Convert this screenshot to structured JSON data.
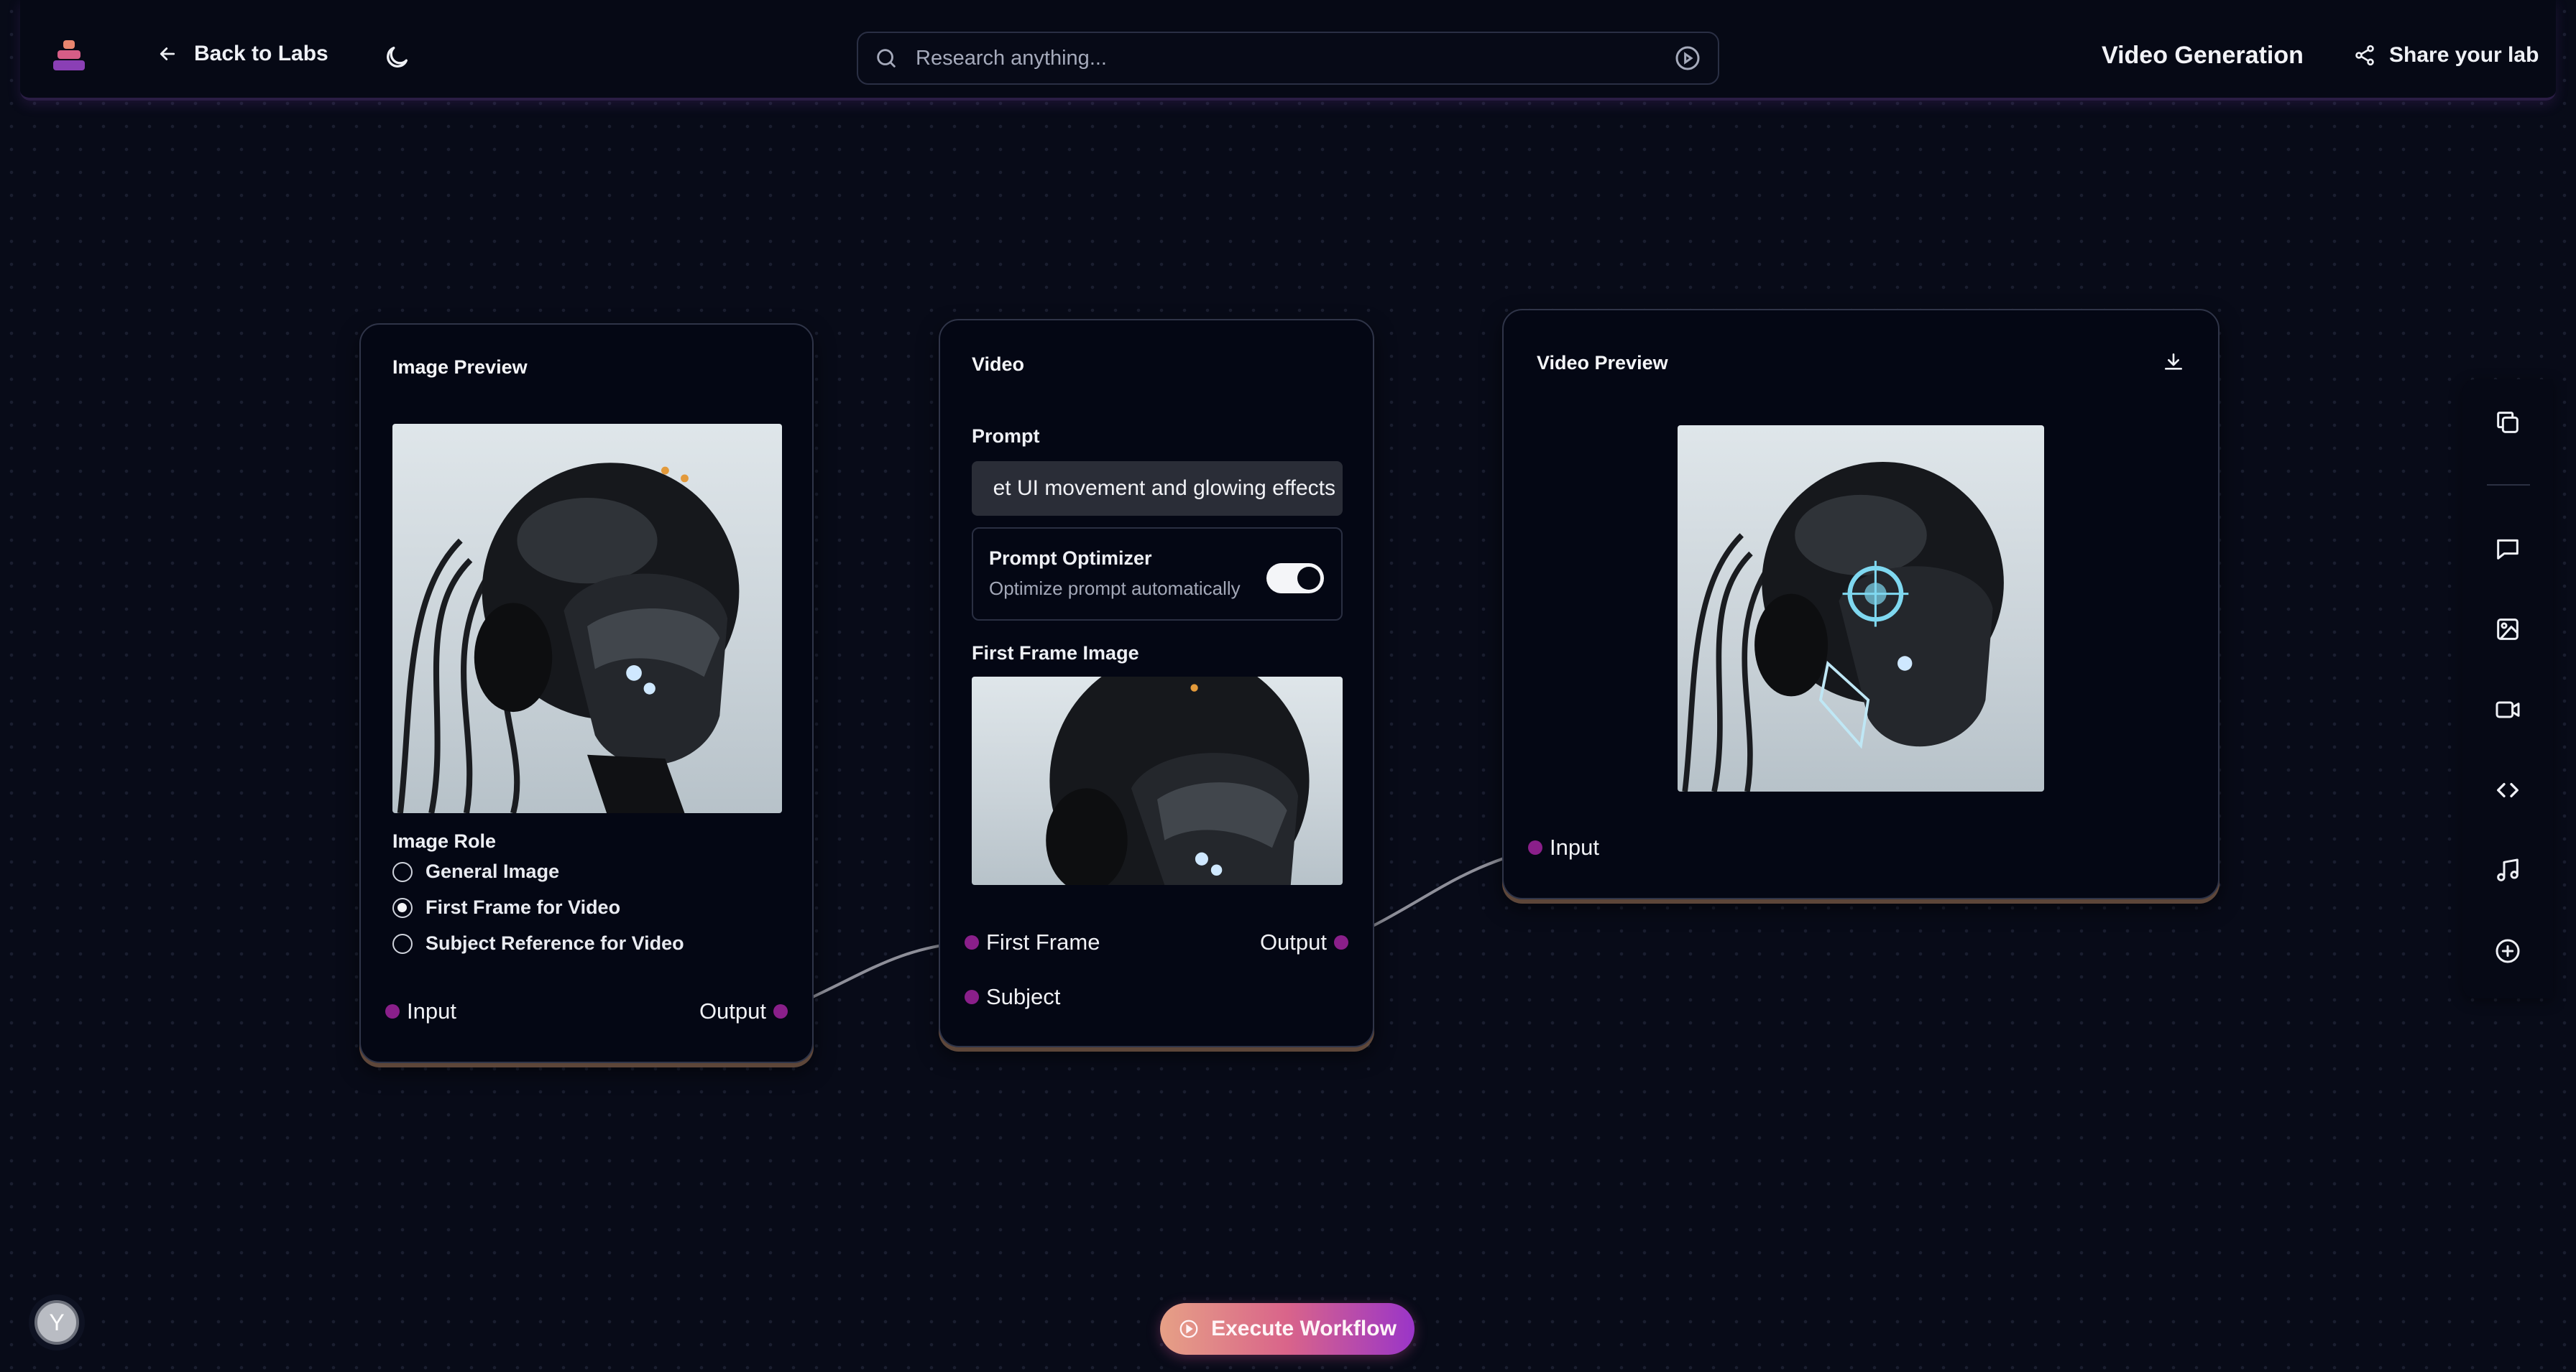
{
  "topbar": {
    "back_label": "Back to Labs",
    "search_placeholder": "Research anything...",
    "title": "Video Generation",
    "share_label": "Share your lab"
  },
  "nodes": {
    "image_preview": {
      "title": "Image Preview",
      "image_role_label": "Image Role",
      "roles": [
        {
          "label": "General Image",
          "selected": false
        },
        {
          "label": "First Frame for Video",
          "selected": true
        },
        {
          "label": "Subject Reference for Video",
          "selected": false
        }
      ],
      "input_port": "Input",
      "output_port": "Output"
    },
    "video": {
      "title": "Video",
      "prompt_label": "Prompt",
      "prompt_value": "et UI movement and glowing effects",
      "optimizer_title": "Prompt Optimizer",
      "optimizer_desc": "Optimize prompt automatically",
      "optimizer_enabled": true,
      "first_frame_label": "First Frame Image",
      "first_frame_port": "First Frame",
      "subject_port": "Subject",
      "output_port": "Output"
    },
    "video_preview": {
      "title": "Video Preview",
      "input_port": "Input"
    }
  },
  "sidebar": {
    "items": [
      "copy-icon",
      "message-icon",
      "image-icon",
      "video-icon",
      "code-icon",
      "music-icon",
      "add-icon"
    ]
  },
  "execute_label": "Execute Workflow",
  "avatar_initial": "Y",
  "colors": {
    "background": "#080b18",
    "port": "#8a1f8a",
    "accent_gradient_start": "#e6a086",
    "accent_gradient_end": "#9a35c8"
  }
}
